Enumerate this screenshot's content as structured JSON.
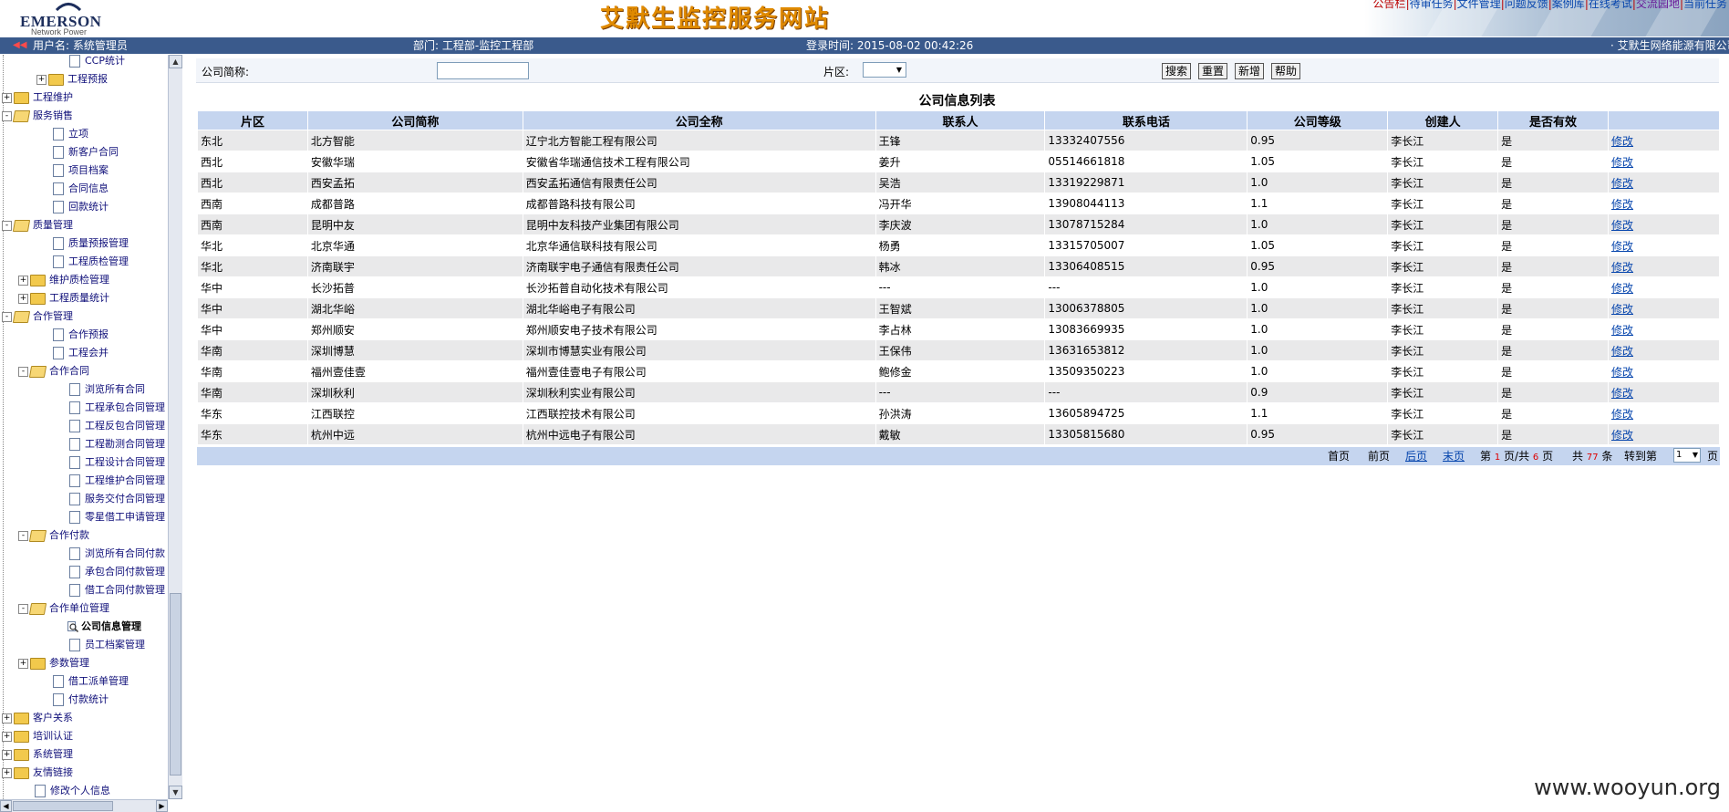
{
  "header": {
    "logo_brand": "EMERSON",
    "logo_sub": "Network Power",
    "site_title": "艾默生监控服务网站",
    "top_links": [
      "公告栏",
      "待审任务",
      "文件管理",
      "问题反馈",
      "案例库",
      "在线考试",
      "交流园地",
      "当前任务"
    ]
  },
  "infobar": {
    "user": "用户名: 系统管理员",
    "dept": "部门: 工程部-监控工程部",
    "login_time": "登录时间: 2015-08-02 00:42:26",
    "company": "· 艾默生网络能源有限公司"
  },
  "tree": [
    {
      "label": "CCP统计",
      "type": "page"
    },
    {
      "label": "工程预报",
      "type": "folder",
      "toggle": "+"
    },
    {
      "label": "工程维护",
      "type": "folder",
      "toggle": "+"
    },
    {
      "label": "服务销售",
      "type": "folder-open",
      "toggle": "-"
    },
    {
      "label": "立项",
      "type": "page"
    },
    {
      "label": "新客户合同",
      "type": "page"
    },
    {
      "label": "项目档案",
      "type": "page"
    },
    {
      "label": "合同信息",
      "type": "page"
    },
    {
      "label": "回款统计",
      "type": "page"
    },
    {
      "label": "质量管理",
      "type": "folder-open",
      "toggle": "-"
    },
    {
      "label": "质量预报管理",
      "type": "page"
    },
    {
      "label": "工程质检管理",
      "type": "page"
    },
    {
      "label": "维护质检管理",
      "type": "folder",
      "toggle": "+"
    },
    {
      "label": "工程质量统计",
      "type": "folder",
      "toggle": "+"
    },
    {
      "label": "合作管理",
      "type": "folder-open",
      "toggle": "-"
    },
    {
      "label": "合作预报",
      "type": "page"
    },
    {
      "label": "工程会并",
      "type": "page"
    },
    {
      "label": "合作合同",
      "type": "folder-open",
      "toggle": "-"
    },
    {
      "label": "浏览所有合同",
      "type": "page"
    },
    {
      "label": "工程承包合同管理",
      "type": "page"
    },
    {
      "label": "工程反包合同管理",
      "type": "page"
    },
    {
      "label": "工程勘测合同管理",
      "type": "page"
    },
    {
      "label": "工程设计合同管理",
      "type": "page"
    },
    {
      "label": "工程维护合同管理",
      "type": "page"
    },
    {
      "label": "服务交付合同管理",
      "type": "page"
    },
    {
      "label": "零星借工申请管理",
      "type": "page"
    },
    {
      "label": "合作付款",
      "type": "folder-open",
      "toggle": "-"
    },
    {
      "label": "浏览所有合同付款",
      "type": "page"
    },
    {
      "label": "承包合同付款管理",
      "type": "page"
    },
    {
      "label": "借工合同付款管理",
      "type": "page"
    },
    {
      "label": "合作单位管理",
      "type": "folder-open",
      "toggle": "-"
    },
    {
      "label": "公司信息管理",
      "type": "mag",
      "bold": true
    },
    {
      "label": "员工档案管理",
      "type": "page"
    },
    {
      "label": "参数管理",
      "type": "folder",
      "toggle": "+"
    },
    {
      "label": "借工派单管理",
      "type": "page"
    },
    {
      "label": "付款统计",
      "type": "page"
    },
    {
      "label": "客户关系",
      "type": "folder",
      "toggle": "+"
    },
    {
      "label": "培训认证",
      "type": "folder",
      "toggle": "+"
    },
    {
      "label": "系统管理",
      "type": "folder",
      "toggle": "+"
    },
    {
      "label": "友情链接",
      "type": "folder",
      "toggle": "+"
    },
    {
      "label": "修改个人信息",
      "type": "page"
    }
  ],
  "search": {
    "company_label": "公司简称:",
    "company_value": "",
    "region_label": "片区:",
    "region_value": "",
    "buttons": [
      "搜索",
      "重置",
      "新增",
      "帮助"
    ]
  },
  "list": {
    "title": "公司信息列表",
    "columns": [
      "片区",
      "公司简称",
      "公司全称",
      "联系人",
      "联系电话",
      "公司等级",
      "创建人",
      "是否有效",
      ""
    ],
    "rows": [
      [
        "东北",
        "北方智能",
        "辽宁北方智能工程有限公司",
        "王锋",
        "13332407556",
        "0.95",
        "李长江",
        "是",
        "修改"
      ],
      [
        "西北",
        "安徽华瑞",
        "安徽省华瑞通信技术工程有限公司",
        "姜升",
        "05514661818",
        "1.05",
        "李长江",
        "是",
        "修改"
      ],
      [
        "西北",
        "西安孟拓",
        "西安孟拓通信有限责任公司",
        "吴浩",
        "13319229871",
        "1.0",
        "李长江",
        "是",
        "修改"
      ],
      [
        "西南",
        "成都普路",
        "成都普路科技有限公司",
        "冯开华",
        "13908044113",
        "1.1",
        "李长江",
        "是",
        "修改"
      ],
      [
        "西南",
        "昆明中友",
        "昆明中友科技产业集团有限公司",
        "李庆波",
        "13078715284",
        "1.0",
        "李长江",
        "是",
        "修改"
      ],
      [
        "华北",
        "北京华通",
        "北京华通信联科技有限公司",
        "杨勇",
        "13315705007",
        "1.05",
        "李长江",
        "是",
        "修改"
      ],
      [
        "华北",
        "济南联宇",
        "济南联宇电子通信有限责任公司",
        "韩冰",
        "13306408515",
        "0.95",
        "李长江",
        "是",
        "修改"
      ],
      [
        "华中",
        "长沙拓普",
        "长沙拓普自动化技术有限公司",
        "---",
        "---",
        "1.0",
        "李长江",
        "是",
        "修改"
      ],
      [
        "华中",
        "湖北华峪",
        "湖北华峪电子有限公司",
        "王智斌",
        "13006378805",
        "1.0",
        "李长江",
        "是",
        "修改"
      ],
      [
        "华中",
        "郑州顺安",
        "郑州顺安电子技术有限公司",
        "李占林",
        "13083669935",
        "1.0",
        "李长江",
        "是",
        "修改"
      ],
      [
        "华南",
        "深圳博慧",
        "深圳市博慧实业有限公司",
        "王保伟",
        "13631653812",
        "1.0",
        "李长江",
        "是",
        "修改"
      ],
      [
        "华南",
        "福州壹佳壹",
        "福州壹佳壹电子有限公司",
        "鲍修金",
        "13509350223",
        "1.0",
        "李长江",
        "是",
        "修改"
      ],
      [
        "华南",
        "深圳秋利",
        "深圳秋利实业有限公司",
        "---",
        "---",
        "0.9",
        "李长江",
        "是",
        "修改"
      ],
      [
        "华东",
        "江西联控",
        "江西联控技术有限公司",
        "孙洪涛",
        "13605894725",
        "1.1",
        "李长江",
        "是",
        "修改"
      ],
      [
        "华东",
        "杭州中远",
        "杭州中远电子有限公司",
        "戴敏",
        "13305815680",
        "0.95",
        "李长江",
        "是",
        "修改"
      ]
    ]
  },
  "pager": {
    "first": "首页",
    "prev": "前页",
    "next": "后页",
    "last": "末页",
    "page_prefix": "第",
    "current_page": "1",
    "page_mid": "页/共",
    "total_pages": "6",
    "page_suffix": "页",
    "total_prefix": "共",
    "total_records": "77",
    "total_suffix": "条",
    "goto_label": "转到第",
    "goto_value": "1",
    "goto_suffix": "页"
  },
  "watermark": "www.wooyun.org"
}
